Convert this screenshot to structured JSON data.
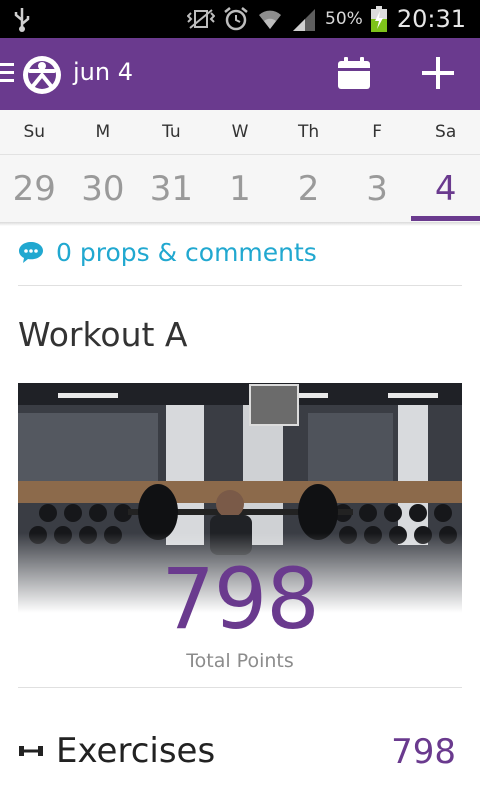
{
  "status_bar": {
    "battery_percent": "50%",
    "time": "20:31",
    "icons": [
      "usb-icon",
      "vibrate-icon",
      "alarm-icon",
      "wifi-icon",
      "signal-icon",
      "battery-charging-icon"
    ]
  },
  "header": {
    "date": "jun 4",
    "icons": [
      "menu-icon",
      "app-logo-icon",
      "calendar-icon",
      "add-icon"
    ],
    "color": "#6a3a8e"
  },
  "week": {
    "labels": [
      "Su",
      "M",
      "Tu",
      "W",
      "Th",
      "F",
      "Sa"
    ],
    "days": [
      "29",
      "30",
      "31",
      "1",
      "2",
      "3",
      "4"
    ],
    "selected_index": 6
  },
  "props": {
    "text": "0 props & comments",
    "icon": "comment-icon",
    "color": "#21a8d0"
  },
  "workout": {
    "title": "Workout A",
    "points": "798",
    "points_label": "Total Points"
  },
  "exercises": {
    "icon": "dumbbell-icon",
    "label": "Exercises",
    "value": "798"
  }
}
